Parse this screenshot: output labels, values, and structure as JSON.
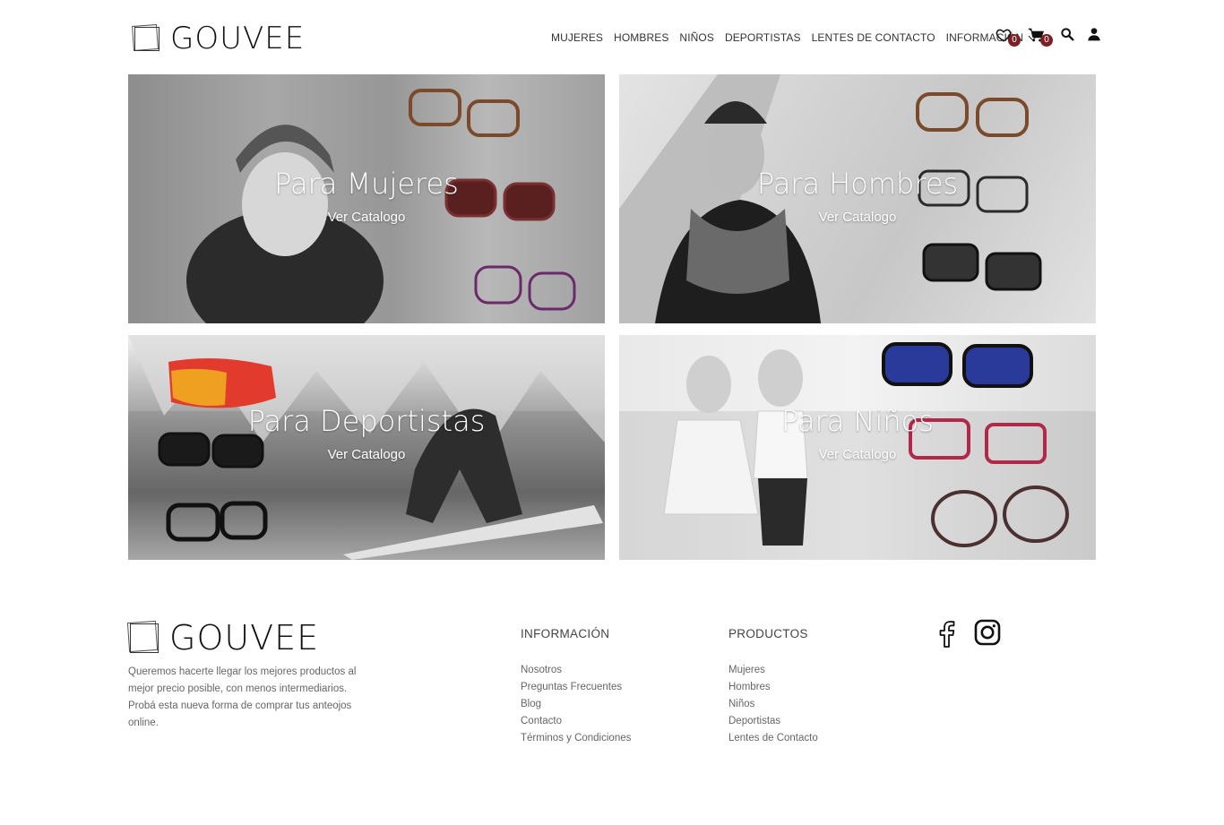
{
  "brand": {
    "name": "GOUVEE"
  },
  "nav": {
    "items": [
      {
        "label": "MUJERES"
      },
      {
        "label": "HOMBRES"
      },
      {
        "label": "NIÑOS"
      },
      {
        "label": "DEPORTISTAS"
      },
      {
        "label": "LENTES DE CONTACTO"
      },
      {
        "label": "INFORMACIÓN"
      }
    ]
  },
  "header_icons": {
    "wishlist_count": "0",
    "cart_count": "0"
  },
  "banners": [
    {
      "title": "Para Mujeres",
      "cta": "Ver Catalogo"
    },
    {
      "title": "Para Hombres",
      "cta": "Ver Catalogo"
    },
    {
      "title": "Para Deportistas",
      "cta": "Ver Catalogo"
    },
    {
      "title": "Para Niños",
      "cta": "Ver Catalogo"
    }
  ],
  "footer": {
    "about": "Queremos hacerte llegar los mejores productos al mejor precio posible, con menos intermediarios. Probá esta nueva forma de comprar tus anteojos online.",
    "info": {
      "heading": "INFORMACIÓN",
      "links": [
        "Nosotros",
        "Preguntas Frecuentes",
        "Blog",
        "Contacto",
        "Términos y Condiciones"
      ]
    },
    "products": {
      "heading": "PRODUCTOS",
      "links": [
        "Mujeres",
        "Hombres",
        "Niños",
        "Deportistas",
        "Lentes de Contacto"
      ]
    }
  },
  "colors": {
    "badge": "#7d1f24",
    "text": "#222222",
    "muted": "#666666"
  }
}
